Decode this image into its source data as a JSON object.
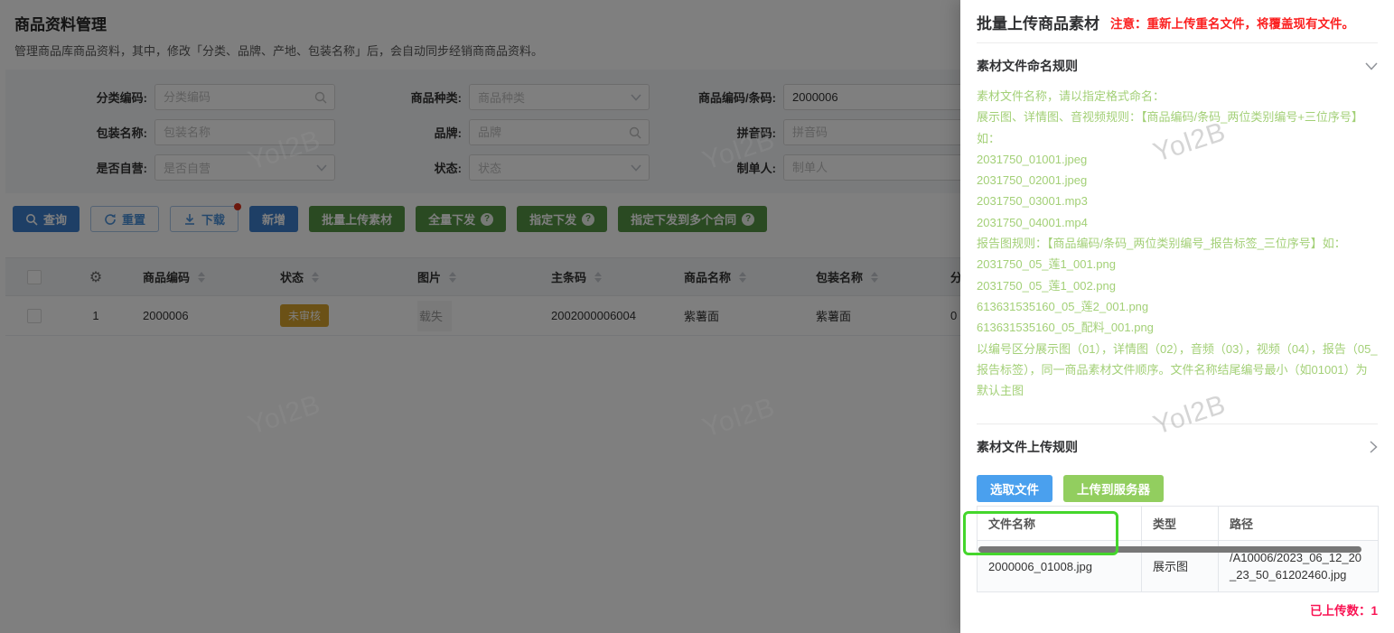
{
  "watermark": "Yol2B",
  "colors": {
    "primary_blue": "#3c7ecc",
    "action_green": "#549444",
    "drawer_pick_blue": "#4aa0ee",
    "drawer_upload_green": "#92ce5f",
    "highlight_green": "#44d62c",
    "notice_red": "#fb2020",
    "uploaded_red": "#f91454",
    "status_badge_orange": "#d6a32c",
    "rules_text_green": "#a3d077"
  },
  "page": {
    "title": "商品资料管理",
    "subtitle": "管理商品库商品资料，其中，修改「分类、品牌、产地、包装名称」后，会自动同步经销商商品资料。"
  },
  "filter": {
    "fields": [
      {
        "label": "分类编码:",
        "placeholder": "分类编码"
      },
      {
        "label": "商品种类:",
        "placeholder": "商品种类"
      },
      {
        "label": "商品编码/条码:",
        "value": "2000006"
      },
      {
        "label": "包装名称:",
        "placeholder": "包装名称"
      },
      {
        "label": "品牌:",
        "placeholder": "品牌"
      },
      {
        "label": "拼音码:",
        "placeholder": "拼音码"
      },
      {
        "label": "是否自营:",
        "placeholder": "是否自营"
      },
      {
        "label": "状态:",
        "placeholder": "状态"
      },
      {
        "label": "制单人:",
        "placeholder": "制单人"
      }
    ]
  },
  "toolbar": {
    "query": "查询",
    "reset": "重置",
    "download": "下载",
    "add": "新增",
    "batch_upload": "批量上传素材",
    "full_publish": "全量下发",
    "assign_publish": "指定下发",
    "assign_publish_multi": "指定下发到多个合同",
    "help_mark": "?"
  },
  "table": {
    "columns": [
      "商品编码",
      "状态",
      "图片",
      "主条码",
      "商品名称",
      "包装名称",
      "分"
    ],
    "row": {
      "index": "1",
      "code": "2000006",
      "status": "未审核",
      "image_text": "载失",
      "barcode": "2002000006004",
      "name": "紫薯面",
      "package": "紫薯面",
      "truncated": "0"
    }
  },
  "drawer": {
    "title": "批量上传商品素材",
    "notice": "注意：重新上传重名文件，将覆盖现有文件。",
    "naming_section": "素材文件命名规则",
    "upload_section": "素材文件上传规则",
    "rules": [
      "素材文件名称，请以指定格式命名：",
      "展示图、详情图、音视频规则：【商品编码/条码_两位类别编号+三位序号】如：",
      "2031750_01001.jpeg",
      "2031750_02001.jpeg",
      "2031750_03001.mp3",
      "2031750_04001.mp4",
      "报告图规则：【商品编码/条码_两位类别编号_报告标签_三位序号】如：",
      "2031750_05_莲1_001.png",
      "2031750_05_莲1_002.png",
      "613631535160_05_莲2_001.png",
      "613631535160_05_配料_001.png",
      "以编号区分展示图（01），详情图（02），音频（03），视频（04），报告（05_报告标签），同一商品素材文件顺序。文件名称结尾编号最小（如01001）为默认主图"
    ],
    "pick_button": "选取文件",
    "upload_button": "上传到服务器",
    "file_table": {
      "columns": [
        "文件名称",
        "类型",
        "路径"
      ],
      "row": {
        "name": "2000006_01008.jpg",
        "type": "展示图",
        "path": "/A10006/2023_06_12_20_23_50_61202460.jpg"
      }
    },
    "uploaded_label": "已上传数：1"
  }
}
